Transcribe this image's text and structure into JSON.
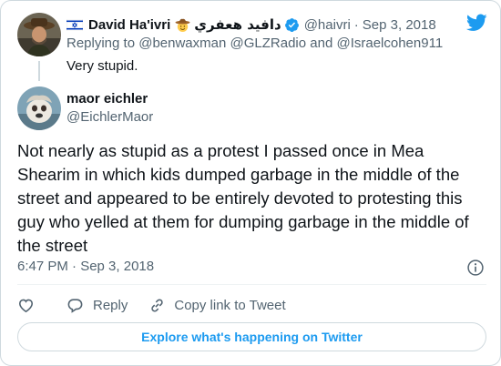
{
  "parent_tweet": {
    "display_name": "David Ha'ivri",
    "display_name_arabic": "دافيد هعفري",
    "handle": "@haivri",
    "separator": "·",
    "date": "Sep 3, 2018",
    "replying_prefix": "Replying to",
    "replying_to": [
      "@benwaxman",
      "@GLZRadio",
      "@Israelcohen911"
    ],
    "replying_joiner": "and",
    "text": "Very stupid."
  },
  "main_tweet": {
    "display_name": "maor eichler",
    "handle": "@EichlerMaor",
    "text": "Not nearly as stupid as a protest I passed once in Mea Shearim in which kids dumped garbage in the middle of the street and appeared to be entirely devoted to protesting this guy who yelled at them for dumping garbage in the middle of the street",
    "timestamp": "6:47 PM · Sep 3, 2018"
  },
  "actions": {
    "reply_label": "Reply",
    "copy_link_label": "Copy link to Tweet"
  },
  "explore_button": "Explore what's happening on Twitter",
  "colors": {
    "accent": "#1d9bf0",
    "muted_text": "#536471",
    "border": "#cfd9de"
  },
  "icons": [
    "israel-flag-icon",
    "cowboy-emoji-icon",
    "verified-badge-icon",
    "twitter-bird-icon",
    "info-icon",
    "heart-icon",
    "reply-icon",
    "link-icon"
  ]
}
